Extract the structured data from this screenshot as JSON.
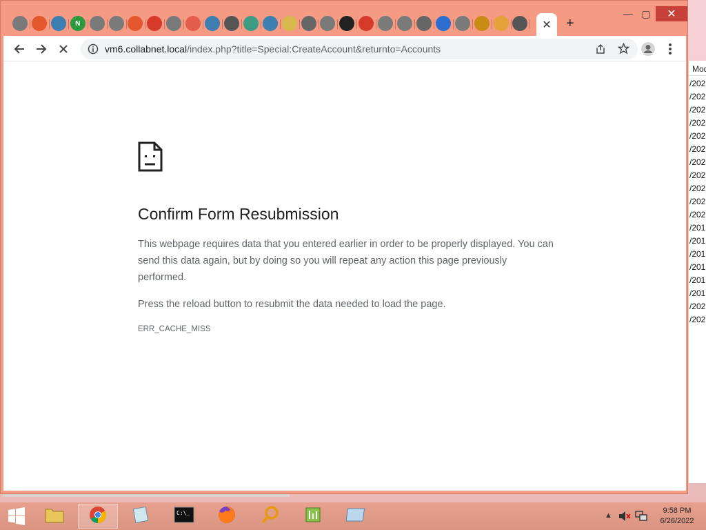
{
  "background_window": {
    "header": "Mod",
    "rows": [
      "/202",
      "/202",
      "/202",
      "/202",
      "/202",
      "/202",
      "/202",
      "/202",
      "/202",
      "/202",
      "/202",
      "/201",
      "/201",
      "/201",
      "/201",
      "/201",
      "/201",
      "/202",
      "/202"
    ]
  },
  "browser": {
    "tabs": [
      {
        "icon": "globe-icon",
        "color": "#7a7a7a",
        "glyph": ""
      },
      {
        "icon": "app-icon",
        "color": "#e2572b",
        "glyph": ""
      },
      {
        "icon": "sqlite-icon",
        "color": "#3c7fb0",
        "glyph": ""
      },
      {
        "icon": "nginx-icon",
        "color": "#2a9a3c",
        "glyph": "N"
      },
      {
        "icon": "globe-icon",
        "color": "#7a7a7a",
        "glyph": ""
      },
      {
        "icon": "globe-icon",
        "color": "#7a7a7a",
        "glyph": ""
      },
      {
        "icon": "windows-icon",
        "color": "#e4572e",
        "glyph": ""
      },
      {
        "icon": "opera-icon",
        "color": "#d63a2a",
        "glyph": ""
      },
      {
        "icon": "globe-icon",
        "color": "#7a7a7a",
        "glyph": ""
      },
      {
        "icon": "calendar-icon",
        "color": "#e45d4a",
        "glyph": ""
      },
      {
        "icon": "sqlite-icon",
        "color": "#3c7fb0",
        "glyph": ""
      },
      {
        "icon": "chrome-icon",
        "color": "#555555",
        "glyph": ""
      },
      {
        "icon": "network-icon",
        "color": "#3b9c83",
        "glyph": ""
      },
      {
        "icon": "sqlite-icon",
        "color": "#3c7fb0",
        "glyph": ""
      },
      {
        "icon": "folder-icon",
        "color": "#d7b84a",
        "glyph": ""
      },
      {
        "icon": "gear-icon",
        "color": "#666666",
        "glyph": ""
      },
      {
        "icon": "globe-icon",
        "color": "#7a7a7a",
        "glyph": ""
      },
      {
        "icon": "app-icon",
        "color": "#222222",
        "glyph": ""
      },
      {
        "icon": "opera-icon",
        "color": "#d63a2a",
        "glyph": ""
      },
      {
        "icon": "globe-icon",
        "color": "#7a7a7a",
        "glyph": ""
      },
      {
        "icon": "globe-icon",
        "color": "#7a7a7a",
        "glyph": ""
      },
      {
        "icon": "gear-icon",
        "color": "#666666",
        "glyph": ""
      },
      {
        "icon": "cloud-icon",
        "color": "#2d6fd1",
        "glyph": ""
      },
      {
        "icon": "globe-icon",
        "color": "#7a7a7a",
        "glyph": ""
      },
      {
        "icon": "magnifier-icon",
        "color": "#c98a16",
        "glyph": ""
      },
      {
        "icon": "app-icon",
        "color": "#e6a23a",
        "glyph": ""
      },
      {
        "icon": "chrome-icon",
        "color": "#555555",
        "glyph": ""
      }
    ],
    "active_tab_close": "✕",
    "new_tab": "+",
    "window_controls": {
      "minimize": "—",
      "maximize": "▢",
      "close": "✕"
    },
    "address": {
      "host": "vm6.collabnet.local",
      "path": "/index.php?title=Special:CreateAccount&returnto=Accounts"
    },
    "accent": "#f59a83"
  },
  "error_page": {
    "title": "Confirm Form Resubmission",
    "paragraph1": "This webpage requires data that you entered earlier in order to be properly displayed. You can send this data again, but by doing so you will repeat any action this page previously performed.",
    "paragraph2": "Press the reload button to resubmit the data needed to load the page.",
    "error_code": "ERR_CACHE_MISS"
  },
  "taskbar": {
    "apps": [
      {
        "name": "file-explorer",
        "icon": "folder-icon",
        "active": false
      },
      {
        "name": "chrome",
        "icon": "chrome-icon",
        "active": true
      },
      {
        "name": "notepad",
        "icon": "notepad-icon",
        "active": false
      },
      {
        "name": "terminal",
        "icon": "terminal-icon",
        "active": false
      },
      {
        "name": "firefox",
        "icon": "firefox-icon",
        "active": false
      },
      {
        "name": "search-app",
        "icon": "magnifier-icon",
        "active": false
      },
      {
        "name": "editor",
        "icon": "editor-icon",
        "active": false
      },
      {
        "name": "remote-desktop",
        "icon": "window-icon",
        "active": false
      }
    ],
    "clock_time": "9:58 PM",
    "clock_date": "6/26/2022"
  }
}
